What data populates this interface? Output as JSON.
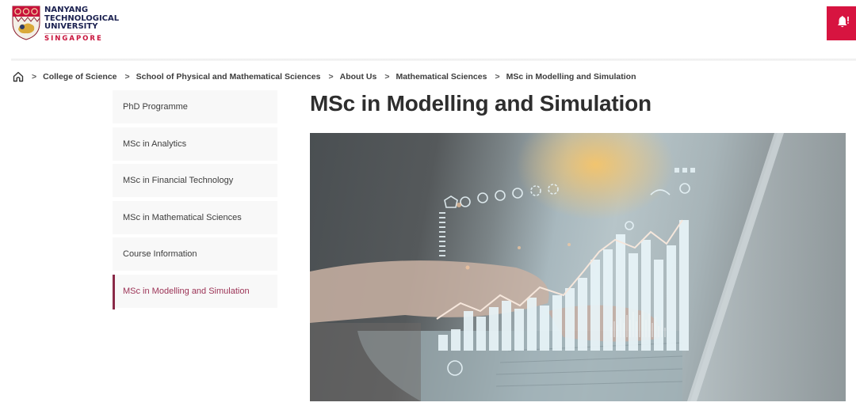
{
  "header": {
    "logo": {
      "lines": [
        "NANYANG",
        "TECHNOLOGICAL",
        "UNIVERSITY"
      ],
      "subline": "SINGAPORE",
      "crest_icon": "ntu-crest-icon"
    },
    "alert_button": {
      "icon": "bell-alert-icon",
      "color": "#d71440"
    }
  },
  "breadcrumb": {
    "home_icon": "home-icon",
    "separator": ">",
    "items": [
      "College of Science",
      "School of Physical and Mathematical Sciences",
      "About Us",
      "Mathematical Sciences",
      "MSc in Modelling and Simulation"
    ]
  },
  "sidebar": {
    "items": [
      {
        "label": "PhD Programme",
        "active": false
      },
      {
        "label": "MSc in Analytics",
        "active": false
      },
      {
        "label": "MSc in Financial Technology",
        "active": false
      },
      {
        "label": "MSc in Mathematical Sciences",
        "active": false
      },
      {
        "label": "Course Information",
        "active": false
      },
      {
        "label": "MSc in Modelling and Simulation",
        "active": true
      }
    ],
    "active_color": "#8a2a48"
  },
  "main": {
    "title": "MSc in Modelling and Simulation",
    "hero_image": "laptop-with-data-analytics-overlay"
  }
}
